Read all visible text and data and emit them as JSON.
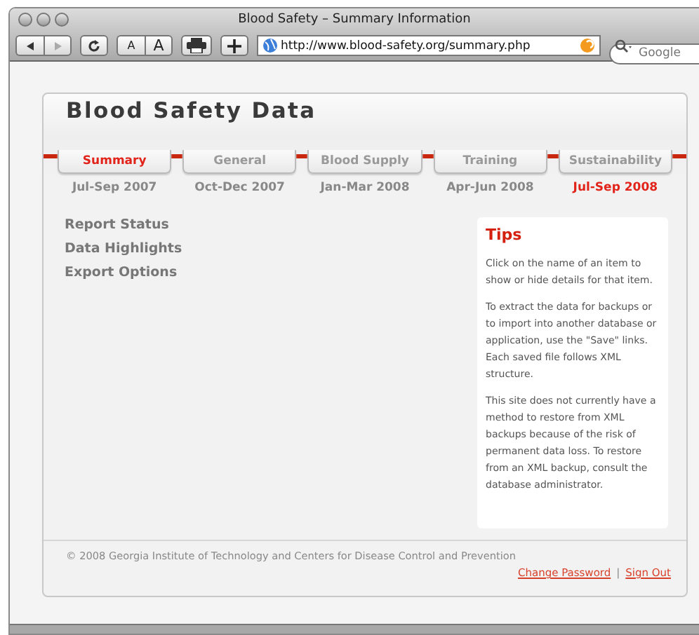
{
  "window": {
    "title": "Blood Safety – Summary Information"
  },
  "toolbar": {
    "url": "http://www.blood-safety.org/summary.php",
    "search": {
      "placeholder": "Google"
    },
    "text_small": "A",
    "text_large": "A"
  },
  "page": {
    "title": "Blood Safety Data",
    "tabs": [
      {
        "label": "Summary",
        "selected": true
      },
      {
        "label": "General",
        "selected": false
      },
      {
        "label": "Blood Supply",
        "selected": false
      },
      {
        "label": "Training",
        "selected": false
      },
      {
        "label": "Sustainability",
        "selected": false
      }
    ],
    "periods": [
      {
        "label": "Jul-Sep 2007",
        "selected": false
      },
      {
        "label": "Oct-Dec 2007",
        "selected": false
      },
      {
        "label": "Jan-Mar 2008",
        "selected": false
      },
      {
        "label": "Apr-Jun 2008",
        "selected": false
      },
      {
        "label": "Jul-Sep 2008",
        "selected": true
      }
    ],
    "sections": [
      "Report Status",
      "Data Highlights",
      "Export Options"
    ],
    "tips": {
      "title": "Tips",
      "paragraphs": [
        "Click on the name of an item to show or hide details for that item.",
        "To extract the data for backups or to import into another database or application, use the \"Save\" links. Each saved file follows XML structure.",
        "This site does not currently have a method to restore from XML backups because of the risk of permanent data loss. To restore from an XML backup, consult the database administrator."
      ]
    },
    "footer": {
      "copyright": "© 2008 Georgia Institute of Technology and Centers for Disease Control and Prevention",
      "links": [
        "Change Password",
        "Sign Out"
      ],
      "separator": "|"
    }
  }
}
